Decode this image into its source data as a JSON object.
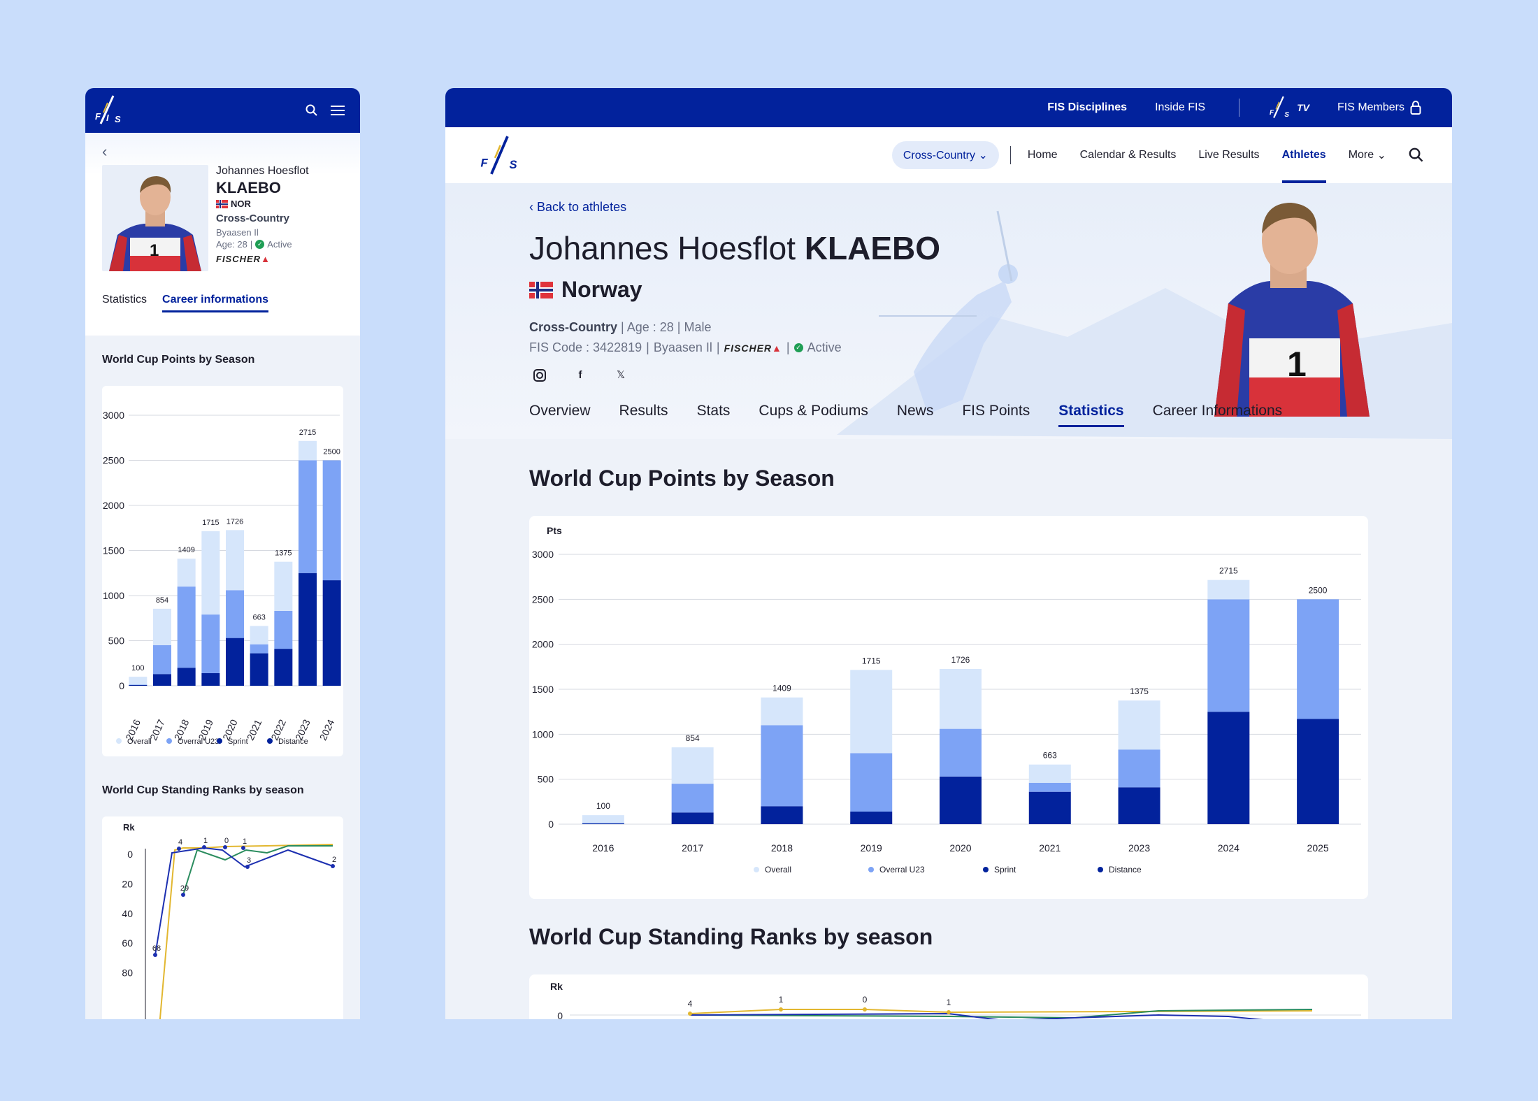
{
  "colors": {
    "brand": "#02229c",
    "overall": "#d6e6fb",
    "overall_u23": "#7da3f5",
    "sprint": "#02229c",
    "distance": "#02229c",
    "rank_yellow": "#e2b730",
    "rank_green": "#2a8c5e",
    "rank_blue": "#1c2fb0"
  },
  "mobile": {
    "logo": "FIS",
    "icons": {
      "search": "search-icon",
      "menu": "menu-icon",
      "back": "chevron-left-icon"
    },
    "athlete": {
      "first_name": "Johannes Hoesflot",
      "last_name": "KLAEBO",
      "nation": "NOR",
      "discipline": "Cross-Country",
      "club": "Byaasen Il",
      "age": "Age: 28",
      "status": "Active",
      "sponsor": "FISCHER"
    },
    "tabs": [
      "Statistics",
      "Career informations"
    ],
    "active_tab": "Career informations",
    "section1_title": "World Cup Points by Season",
    "section2_title": "World Cup Standing Ranks by season"
  },
  "desktop": {
    "top_bar": {
      "disciplines": "FIS Disciplines",
      "inside": "Inside FIS",
      "tv": "TV",
      "members": "FIS Members"
    },
    "nav": {
      "discipline": "Cross-Country",
      "items": [
        "Home",
        "Calendar & Results",
        "Live Results",
        "Athletes",
        "More"
      ],
      "active": "Athletes"
    },
    "back_link": "Back to athletes",
    "athlete": {
      "first_name": "Johannes Hoesflot",
      "last_name": "KLAEBO",
      "country": "Norway",
      "discipline": "Cross-Country",
      "age": "Age : 28",
      "gender": "Male",
      "fis_code": "FIS Code : 3422819",
      "club": "Byaasen Il",
      "sponsor": "FISCHER",
      "status": "Active"
    },
    "social": [
      "instagram-icon",
      "facebook-icon",
      "x-icon"
    ],
    "tabs": [
      "Overview",
      "Results",
      "Stats",
      "Cups & Podiums",
      "News",
      "FIS Points",
      "Statistics",
      "Career Informations"
    ],
    "active_tab": "Statistics",
    "section1_title": "World Cup Points by Season",
    "section2_title": "World Cup Standing Ranks by season"
  },
  "chart_data": [
    {
      "type": "bar",
      "stacked": true,
      "title": "World Cup Points by Season",
      "ylabel": "Pts",
      "ylim": [
        0,
        3000
      ],
      "yticks": [
        0,
        500,
        1000,
        1500,
        2000,
        2500,
        3000
      ],
      "categories": [
        "2016",
        "2017",
        "2018",
        "2019",
        "2020",
        "2021",
        "2023",
        "2024",
        "2025"
      ],
      "totals": [
        100,
        854,
        1409,
        1715,
        1726,
        663,
        1375,
        2715,
        2500
      ],
      "series": [
        {
          "name": "Distance",
          "values": [
            8,
            130,
            200,
            140,
            530,
            360,
            410,
            1250,
            1170
          ]
        },
        {
          "name": "Sprint",
          "values": [
            0,
            0,
            0,
            0,
            0,
            0,
            0,
            0,
            0
          ]
        },
        {
          "name": "Overral U23",
          "values": [
            6,
            320,
            900,
            650,
            530,
            100,
            420,
            1250,
            1330
          ]
        },
        {
          "name": "Overall",
          "values": [
            86,
            404,
            309,
            925,
            666,
            203,
            545,
            215,
            0
          ]
        }
      ],
      "legend": [
        "Overall",
        "Overral U23",
        "Sprint",
        "Distance"
      ],
      "legend_position": "bottom"
    },
    {
      "type": "bar",
      "stacked": true,
      "title": "World Cup Points by Season",
      "ylim": [
        0,
        3000
      ],
      "yticks": [
        0,
        500,
        1000,
        1500,
        2000,
        2500,
        3000
      ],
      "categories": [
        "2016",
        "2017",
        "2018",
        "2019",
        "2020",
        "2021",
        "2022",
        "2023",
        "2024"
      ],
      "totals": [
        100,
        854,
        1409,
        1715,
        1726,
        663,
        1375,
        2715,
        2500
      ],
      "series": [
        {
          "name": "Distance",
          "values": [
            8,
            130,
            200,
            140,
            530,
            360,
            410,
            1250,
            1170
          ]
        },
        {
          "name": "Overral U23",
          "values": [
            6,
            320,
            900,
            650,
            530,
            100,
            420,
            1250,
            1330
          ]
        },
        {
          "name": "Overall",
          "values": [
            86,
            404,
            309,
            925,
            666,
            203,
            545,
            215,
            0
          ]
        }
      ],
      "legend": [
        "Overall",
        "Overral U23",
        "Sprint",
        "Distance"
      ],
      "legend_position": "bottom"
    },
    {
      "type": "line",
      "title": "World Cup Standing Ranks by season",
      "ylabel": "Rk",
      "yticks": [
        0,
        20,
        40,
        60,
        80
      ],
      "series": [
        {
          "name": "Overall",
          "values": [
            4,
            1,
            0,
            null,
            null,
            null,
            null
          ]
        },
        {
          "name": "Sprint",
          "values": [
            68,
            null,
            null,
            1,
            3,
            null,
            2
          ]
        },
        {
          "name": "Distance",
          "values": [
            29
          ]
        }
      ],
      "point_labels": [
        "68",
        "4",
        "29",
        "1",
        "0",
        "1",
        "3",
        "2"
      ]
    }
  ]
}
